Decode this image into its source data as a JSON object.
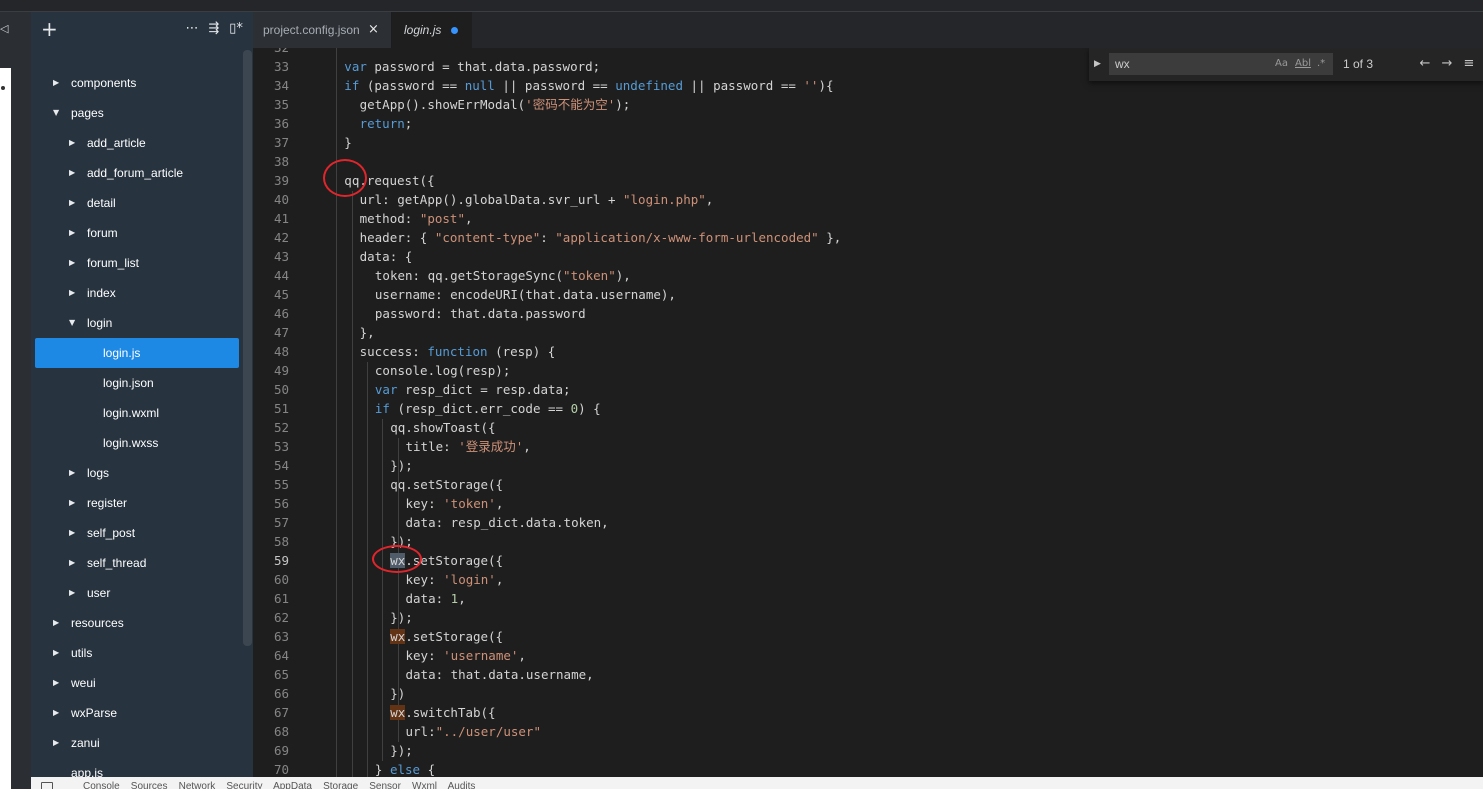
{
  "left_strip": {
    "icon": "◁"
  },
  "sidebar": {
    "actions": [
      {
        "icon": "plus-icon",
        "glyph": "+"
      },
      {
        "icon": "more-icon",
        "glyph": "⋯"
      },
      {
        "icon": "collapse-icon",
        "glyph": "⇶"
      },
      {
        "icon": "split-icon",
        "glyph": "▯*"
      }
    ],
    "tree": [
      {
        "label": "components",
        "depth": 0,
        "caret": "▶"
      },
      {
        "label": "pages",
        "depth": 0,
        "caret": "▼"
      },
      {
        "label": "add_article",
        "depth": 1,
        "caret": "▶"
      },
      {
        "label": "add_forum_article",
        "depth": 1,
        "caret": "▶"
      },
      {
        "label": "detail",
        "depth": 1,
        "caret": "▶"
      },
      {
        "label": "forum",
        "depth": 1,
        "caret": "▶"
      },
      {
        "label": "forum_list",
        "depth": 1,
        "caret": "▶"
      },
      {
        "label": "index",
        "depth": 1,
        "caret": "▶"
      },
      {
        "label": "login",
        "depth": 1,
        "caret": "▼"
      },
      {
        "label": "login.js",
        "depth": 2,
        "caret": "",
        "selected": true
      },
      {
        "label": "login.json",
        "depth": 2,
        "caret": ""
      },
      {
        "label": "login.wxml",
        "depth": 2,
        "caret": ""
      },
      {
        "label": "login.wxss",
        "depth": 2,
        "caret": ""
      },
      {
        "label": "logs",
        "depth": 1,
        "caret": "▶"
      },
      {
        "label": "register",
        "depth": 1,
        "caret": "▶"
      },
      {
        "label": "self_post",
        "depth": 1,
        "caret": "▶"
      },
      {
        "label": "self_thread",
        "depth": 1,
        "caret": "▶"
      },
      {
        "label": "user",
        "depth": 1,
        "caret": "▶"
      },
      {
        "label": "resources",
        "depth": 0,
        "caret": "▶"
      },
      {
        "label": "utils",
        "depth": 0,
        "caret": "▶"
      },
      {
        "label": "weui",
        "depth": 0,
        "caret": "▶"
      },
      {
        "label": "wxParse",
        "depth": 0,
        "caret": "▶"
      },
      {
        "label": "zanui",
        "depth": 0,
        "caret": "▶"
      },
      {
        "label": "app.js",
        "depth": 0,
        "caret": ""
      }
    ]
  },
  "tabs": [
    {
      "label": "project.config.json",
      "close": "×"
    },
    {
      "label": "login.js",
      "modified": true
    }
  ],
  "find": {
    "toggle": "▶",
    "query": "wx",
    "options": [
      "Aa",
      "Abl",
      ".*"
    ],
    "count": "1 of 3",
    "prev": "←",
    "next": "→",
    "more": "≡"
  },
  "editor": {
    "active_line": 59,
    "lines": [
      {
        "n": "32",
        "indent": 1,
        "segs": [
          [
            "",
            ""
          ]
        ]
      },
      {
        "n": "33",
        "indent": 1,
        "segs": [
          [
            "kw",
            "var"
          ],
          [
            "",
            " password = that.data.password;"
          ]
        ]
      },
      {
        "n": "34",
        "indent": 1,
        "segs": [
          [
            "kw",
            "if"
          ],
          [
            "",
            " (password == "
          ],
          [
            "kw",
            "null"
          ],
          [
            "",
            " || password == "
          ],
          [
            "kw",
            "undefined"
          ],
          [
            "",
            " || password == "
          ],
          [
            "str",
            "''"
          ],
          [
            "",
            "){"
          ]
        ]
      },
      {
        "n": "35",
        "indent": 2,
        "segs": [
          [
            "",
            "getApp().showErrModal("
          ],
          [
            "str",
            "'密码不能为空'"
          ],
          [
            "",
            ");"
          ]
        ]
      },
      {
        "n": "36",
        "indent": 2,
        "segs": [
          [
            "kw",
            "return"
          ],
          [
            "",
            ";"
          ]
        ]
      },
      {
        "n": "37",
        "indent": 1,
        "segs": [
          [
            "",
            "}"
          ]
        ]
      },
      {
        "n": "38",
        "indent": 1,
        "segs": [
          [
            "",
            ""
          ]
        ]
      },
      {
        "n": "39",
        "indent": 1,
        "segs": [
          [
            "",
            "qq.request({"
          ]
        ]
      },
      {
        "n": "40",
        "indent": 2,
        "segs": [
          [
            "",
            "url: getApp().globalData.svr_url + "
          ],
          [
            "str",
            "\"login.php\""
          ],
          [
            "",
            ","
          ]
        ]
      },
      {
        "n": "41",
        "indent": 2,
        "segs": [
          [
            "",
            "method: "
          ],
          [
            "str",
            "\"post\""
          ],
          [
            "",
            ","
          ]
        ]
      },
      {
        "n": "42",
        "indent": 2,
        "segs": [
          [
            "",
            "header: { "
          ],
          [
            "str",
            "\"content-type\""
          ],
          [
            "",
            ": "
          ],
          [
            "str",
            "\"application/x-www-form-urlencoded\""
          ],
          [
            "",
            " },"
          ]
        ]
      },
      {
        "n": "43",
        "indent": 2,
        "segs": [
          [
            "",
            "data: {"
          ]
        ]
      },
      {
        "n": "44",
        "indent": 3,
        "segs": [
          [
            "",
            "token: qq.getStorageSync("
          ],
          [
            "str",
            "\"token\""
          ],
          [
            "",
            "),"
          ]
        ]
      },
      {
        "n": "45",
        "indent": 3,
        "segs": [
          [
            "",
            "username: encodeURI(that.data.username),"
          ]
        ]
      },
      {
        "n": "46",
        "indent": 3,
        "segs": [
          [
            "",
            "password: that.data.password"
          ]
        ]
      },
      {
        "n": "47",
        "indent": 2,
        "segs": [
          [
            "",
            "},"
          ]
        ]
      },
      {
        "n": "48",
        "indent": 2,
        "segs": [
          [
            "",
            "success: "
          ],
          [
            "kw",
            "function"
          ],
          [
            "",
            " (resp) {"
          ]
        ]
      },
      {
        "n": "49",
        "indent": 3,
        "segs": [
          [
            "",
            "console.log(resp);"
          ]
        ]
      },
      {
        "n": "50",
        "indent": 3,
        "segs": [
          [
            "kw",
            "var"
          ],
          [
            "",
            " resp_dict = resp.data;"
          ]
        ]
      },
      {
        "n": "51",
        "indent": 3,
        "segs": [
          [
            "kw",
            "if"
          ],
          [
            "",
            " (resp_dict.err_code == "
          ],
          [
            "num",
            "0"
          ],
          [
            "",
            ") {"
          ]
        ]
      },
      {
        "n": "52",
        "indent": 4,
        "segs": [
          [
            "",
            "qq.showToast({"
          ]
        ]
      },
      {
        "n": "53",
        "indent": 5,
        "segs": [
          [
            "",
            "title: "
          ],
          [
            "str",
            "'登录成功'"
          ],
          [
            "",
            ","
          ]
        ]
      },
      {
        "n": "54",
        "indent": 4,
        "segs": [
          [
            "",
            "});"
          ]
        ]
      },
      {
        "n": "55",
        "indent": 4,
        "segs": [
          [
            "",
            "qq.setStorage({"
          ]
        ]
      },
      {
        "n": "56",
        "indent": 5,
        "segs": [
          [
            "",
            "key: "
          ],
          [
            "str",
            "'token'"
          ],
          [
            "",
            ","
          ]
        ]
      },
      {
        "n": "57",
        "indent": 5,
        "segs": [
          [
            "",
            "data: resp_dict.data.token,"
          ]
        ]
      },
      {
        "n": "58",
        "indent": 4,
        "segs": [
          [
            "",
            "});"
          ]
        ]
      },
      {
        "n": "59",
        "indent": 4,
        "segs": [
          [
            "hl-cur",
            "wx"
          ],
          [
            "",
            ".setStorage({"
          ]
        ]
      },
      {
        "n": "60",
        "indent": 5,
        "segs": [
          [
            "",
            "key: "
          ],
          [
            "str",
            "'login'"
          ],
          [
            "",
            ","
          ]
        ]
      },
      {
        "n": "61",
        "indent": 5,
        "segs": [
          [
            "",
            "data: "
          ],
          [
            "num",
            "1"
          ],
          [
            "",
            ","
          ]
        ]
      },
      {
        "n": "62",
        "indent": 4,
        "segs": [
          [
            "",
            "});"
          ]
        ]
      },
      {
        "n": "63",
        "indent": 4,
        "segs": [
          [
            "hl",
            "wx"
          ],
          [
            "",
            ".setStorage({"
          ]
        ]
      },
      {
        "n": "64",
        "indent": 5,
        "segs": [
          [
            "",
            "key: "
          ],
          [
            "str",
            "'username'"
          ],
          [
            "",
            ","
          ]
        ]
      },
      {
        "n": "65",
        "indent": 5,
        "segs": [
          [
            "",
            "data: that.data.username,"
          ]
        ]
      },
      {
        "n": "66",
        "indent": 4,
        "segs": [
          [
            "",
            "})"
          ]
        ]
      },
      {
        "n": "67",
        "indent": 4,
        "segs": [
          [
            "hl",
            "wx"
          ],
          [
            "",
            ".switchTab({"
          ]
        ]
      },
      {
        "n": "68",
        "indent": 5,
        "segs": [
          [
            "",
            "url:"
          ],
          [
            "str",
            "\"../user/user\""
          ]
        ]
      },
      {
        "n": "69",
        "indent": 4,
        "segs": [
          [
            "",
            "});"
          ]
        ]
      },
      {
        "n": "70",
        "indent": 3,
        "segs": [
          [
            "",
            "} "
          ],
          [
            "kw",
            "else"
          ],
          [
            "",
            " {"
          ]
        ]
      }
    ]
  },
  "bottom_bar": {
    "text": "Console    Sources    Network    Security    AppData    Storage    Sensor    Wxml    Audits"
  },
  "colors": {
    "accent": "#1e88e5",
    "sidebar_bg": "#27333f",
    "editor_bg": "#1e1e1e",
    "annotation": "#e0262c",
    "keyword": "#569cd6",
    "string": "#ce9178"
  }
}
